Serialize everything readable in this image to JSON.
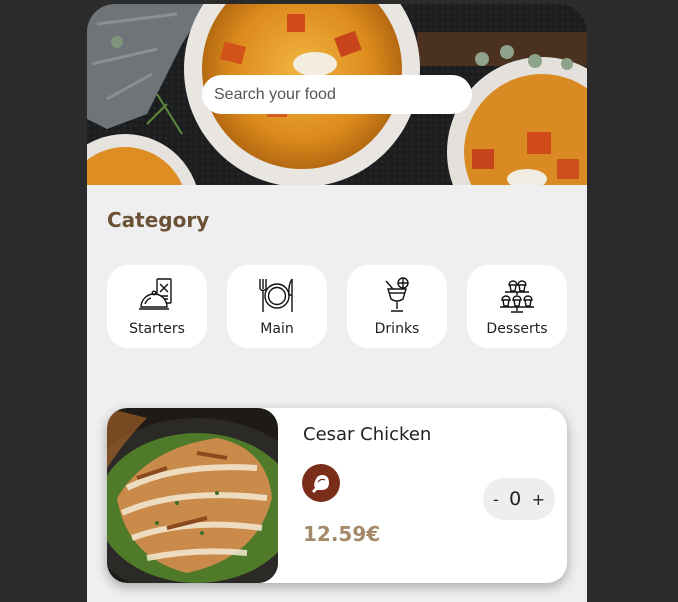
{
  "search": {
    "placeholder": "Search your food"
  },
  "category": {
    "title": "Category",
    "items": [
      {
        "label": "Starters",
        "icon": "cloche-menu-icon"
      },
      {
        "label": "Main",
        "icon": "plate-fork-knife-icon"
      },
      {
        "label": "Drinks",
        "icon": "cocktail-glass-icon"
      },
      {
        "label": "Desserts",
        "icon": "cupcake-stand-icon"
      }
    ]
  },
  "product": {
    "name": "Cesar Chicken",
    "badge_icon": "chicken-leg-icon",
    "price": "12.59€",
    "quantity": "0",
    "minus_label": "-",
    "plus_label": "+"
  },
  "colors": {
    "background": "#2b2b2b",
    "panel": "#efefef",
    "title": "#6b5236",
    "price": "#a48a6a",
    "badge": "#7a2e1a"
  }
}
